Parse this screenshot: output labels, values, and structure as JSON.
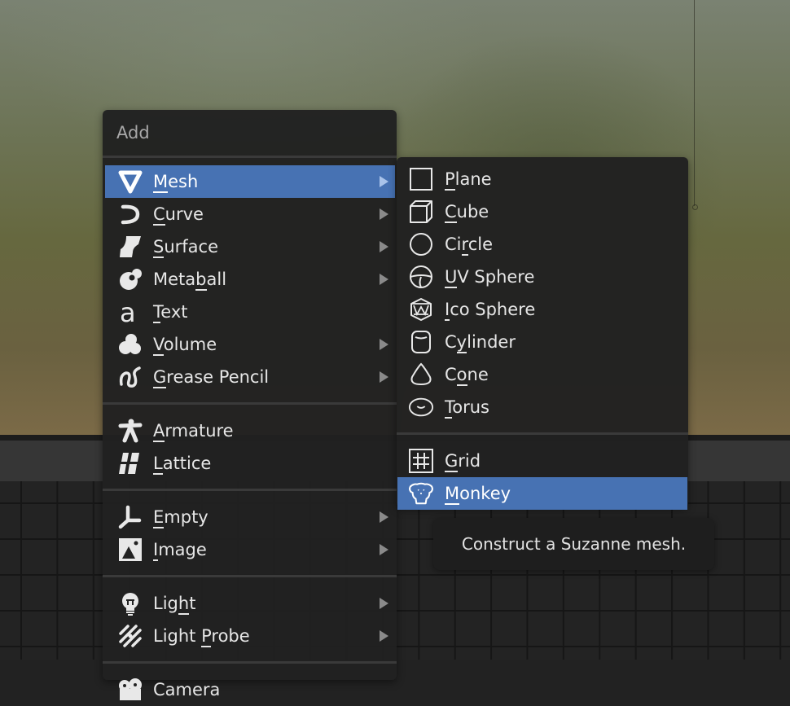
{
  "menu": {
    "title": "Add",
    "groups": [
      [
        {
          "label": "Mesh",
          "underline": "M",
          "icon": "mesh-icon",
          "submenu": true,
          "active": true
        },
        {
          "label": "Curve",
          "underline": "C",
          "icon": "curve-icon",
          "submenu": true
        },
        {
          "label": "Surface",
          "underline": "S",
          "icon": "surface-icon",
          "submenu": true
        },
        {
          "label": "Metaball",
          "underline": "b",
          "icon": "metaball-icon",
          "submenu": true
        },
        {
          "label": "Text",
          "underline": "T",
          "icon": "text-icon",
          "submenu": false
        },
        {
          "label": "Volume",
          "underline": "V",
          "icon": "volume-icon",
          "submenu": true
        },
        {
          "label": "Grease Pencil",
          "underline": "G",
          "icon": "grease-pencil-icon",
          "submenu": true
        }
      ],
      [
        {
          "label": "Armature",
          "underline": "A",
          "icon": "armature-icon",
          "submenu": false
        },
        {
          "label": "Lattice",
          "underline": "L",
          "icon": "lattice-icon",
          "submenu": false
        }
      ],
      [
        {
          "label": "Empty",
          "underline": "E",
          "icon": "empty-icon",
          "submenu": true
        },
        {
          "label": "Image",
          "underline": "I",
          "icon": "image-icon",
          "submenu": true
        }
      ],
      [
        {
          "label": "Light",
          "underline": "h",
          "icon": "light-icon",
          "submenu": true
        },
        {
          "label": "Light Probe",
          "underline": "P",
          "icon": "light-probe-icon",
          "submenu": true
        }
      ],
      [
        {
          "label": "Camera",
          "underline": "",
          "icon": "camera-icon",
          "submenu": false
        }
      ]
    ]
  },
  "submenu": {
    "parent": "Mesh",
    "groups": [
      [
        {
          "label": "Plane",
          "underline": "P",
          "icon": "plane-icon"
        },
        {
          "label": "Cube",
          "underline": "C",
          "icon": "cube-icon"
        },
        {
          "label": "Circle",
          "underline": "r",
          "icon": "circle-icon"
        },
        {
          "label": "UV Sphere",
          "underline": "U",
          "icon": "uv-sphere-icon"
        },
        {
          "label": "Ico Sphere",
          "underline": "I",
          "icon": "ico-sphere-icon"
        },
        {
          "label": "Cylinder",
          "underline": "y",
          "icon": "cylinder-icon"
        },
        {
          "label": "Cone",
          "underline": "o",
          "icon": "cone-icon"
        },
        {
          "label": "Torus",
          "underline": "T",
          "icon": "torus-icon"
        }
      ],
      [
        {
          "label": "Grid",
          "underline": "G",
          "icon": "grid-icon"
        },
        {
          "label": "Monkey",
          "underline": "M",
          "icon": "monkey-icon",
          "active": true
        }
      ]
    ]
  },
  "tooltip": {
    "text": "Construct a Suzanne mesh."
  },
  "colors": {
    "highlight": "#4772b3",
    "menu_bg": "#212121",
    "text": "#e6e6e6",
    "title_text": "#a8a8a8"
  }
}
